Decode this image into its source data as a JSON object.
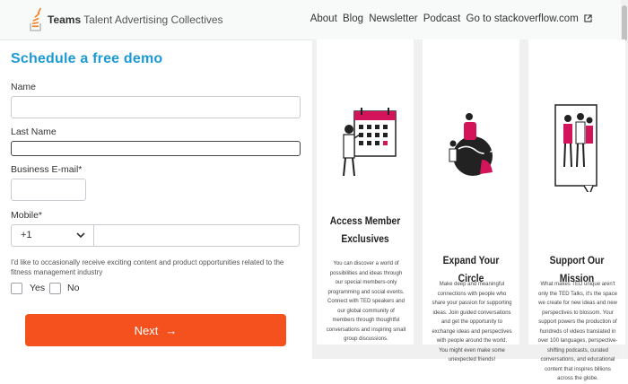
{
  "header": {
    "brand_bold": "Teams",
    "brand_rest": "Talent Advertising Collectives",
    "nav": [
      "About",
      "Blog",
      "Newsletter",
      "Podcast",
      "Go to stackoverflow.com"
    ],
    "ext_icon": "external-link-icon"
  },
  "form": {
    "title": "Schedule a free demo",
    "name_label": "Name",
    "last_name_label": "Last Name",
    "email_label": "Business E-mail*",
    "mobile_label": "Mobile*",
    "country_code": "+1",
    "consent": "I'd like to occasionally receive exciting content and product opportunities related to the fitness management industry",
    "yes_label": "Yes",
    "no_label": "No",
    "next_label": "Next",
    "next_arrow": "→"
  },
  "cards": [
    {
      "title": "Access Member Exclusives",
      "body": "You can discover a world of possibilities and ideas through our special members-only programming and social events. Connect with TED speakers and our global community of members through thoughtful conversations and inspiring small group discussions."
    },
    {
      "title": "Expand Your Circle",
      "body": "Make deep and meaningful connections with people who share your passion for supporting ideas. Join guided conversations and get the opportunity to exchange ideas and perspectives with people around the world. You might even make some unexpected friends!"
    },
    {
      "title": "Support Our Mission",
      "body": "What makes TED unique aren't only the TED Talks, it's the space we create for new ideas and new perspectives to blossom. Your support powers the production of hundreds of videos translated in over 100 languages, perspective-shifting podcasts, curated conversations, and educational content that inspires billions across the globe."
    }
  ],
  "colors": {
    "title_blue": "#1c9ad6",
    "button_orange": "#f4511e",
    "accent_magenta": "#d4145a"
  }
}
